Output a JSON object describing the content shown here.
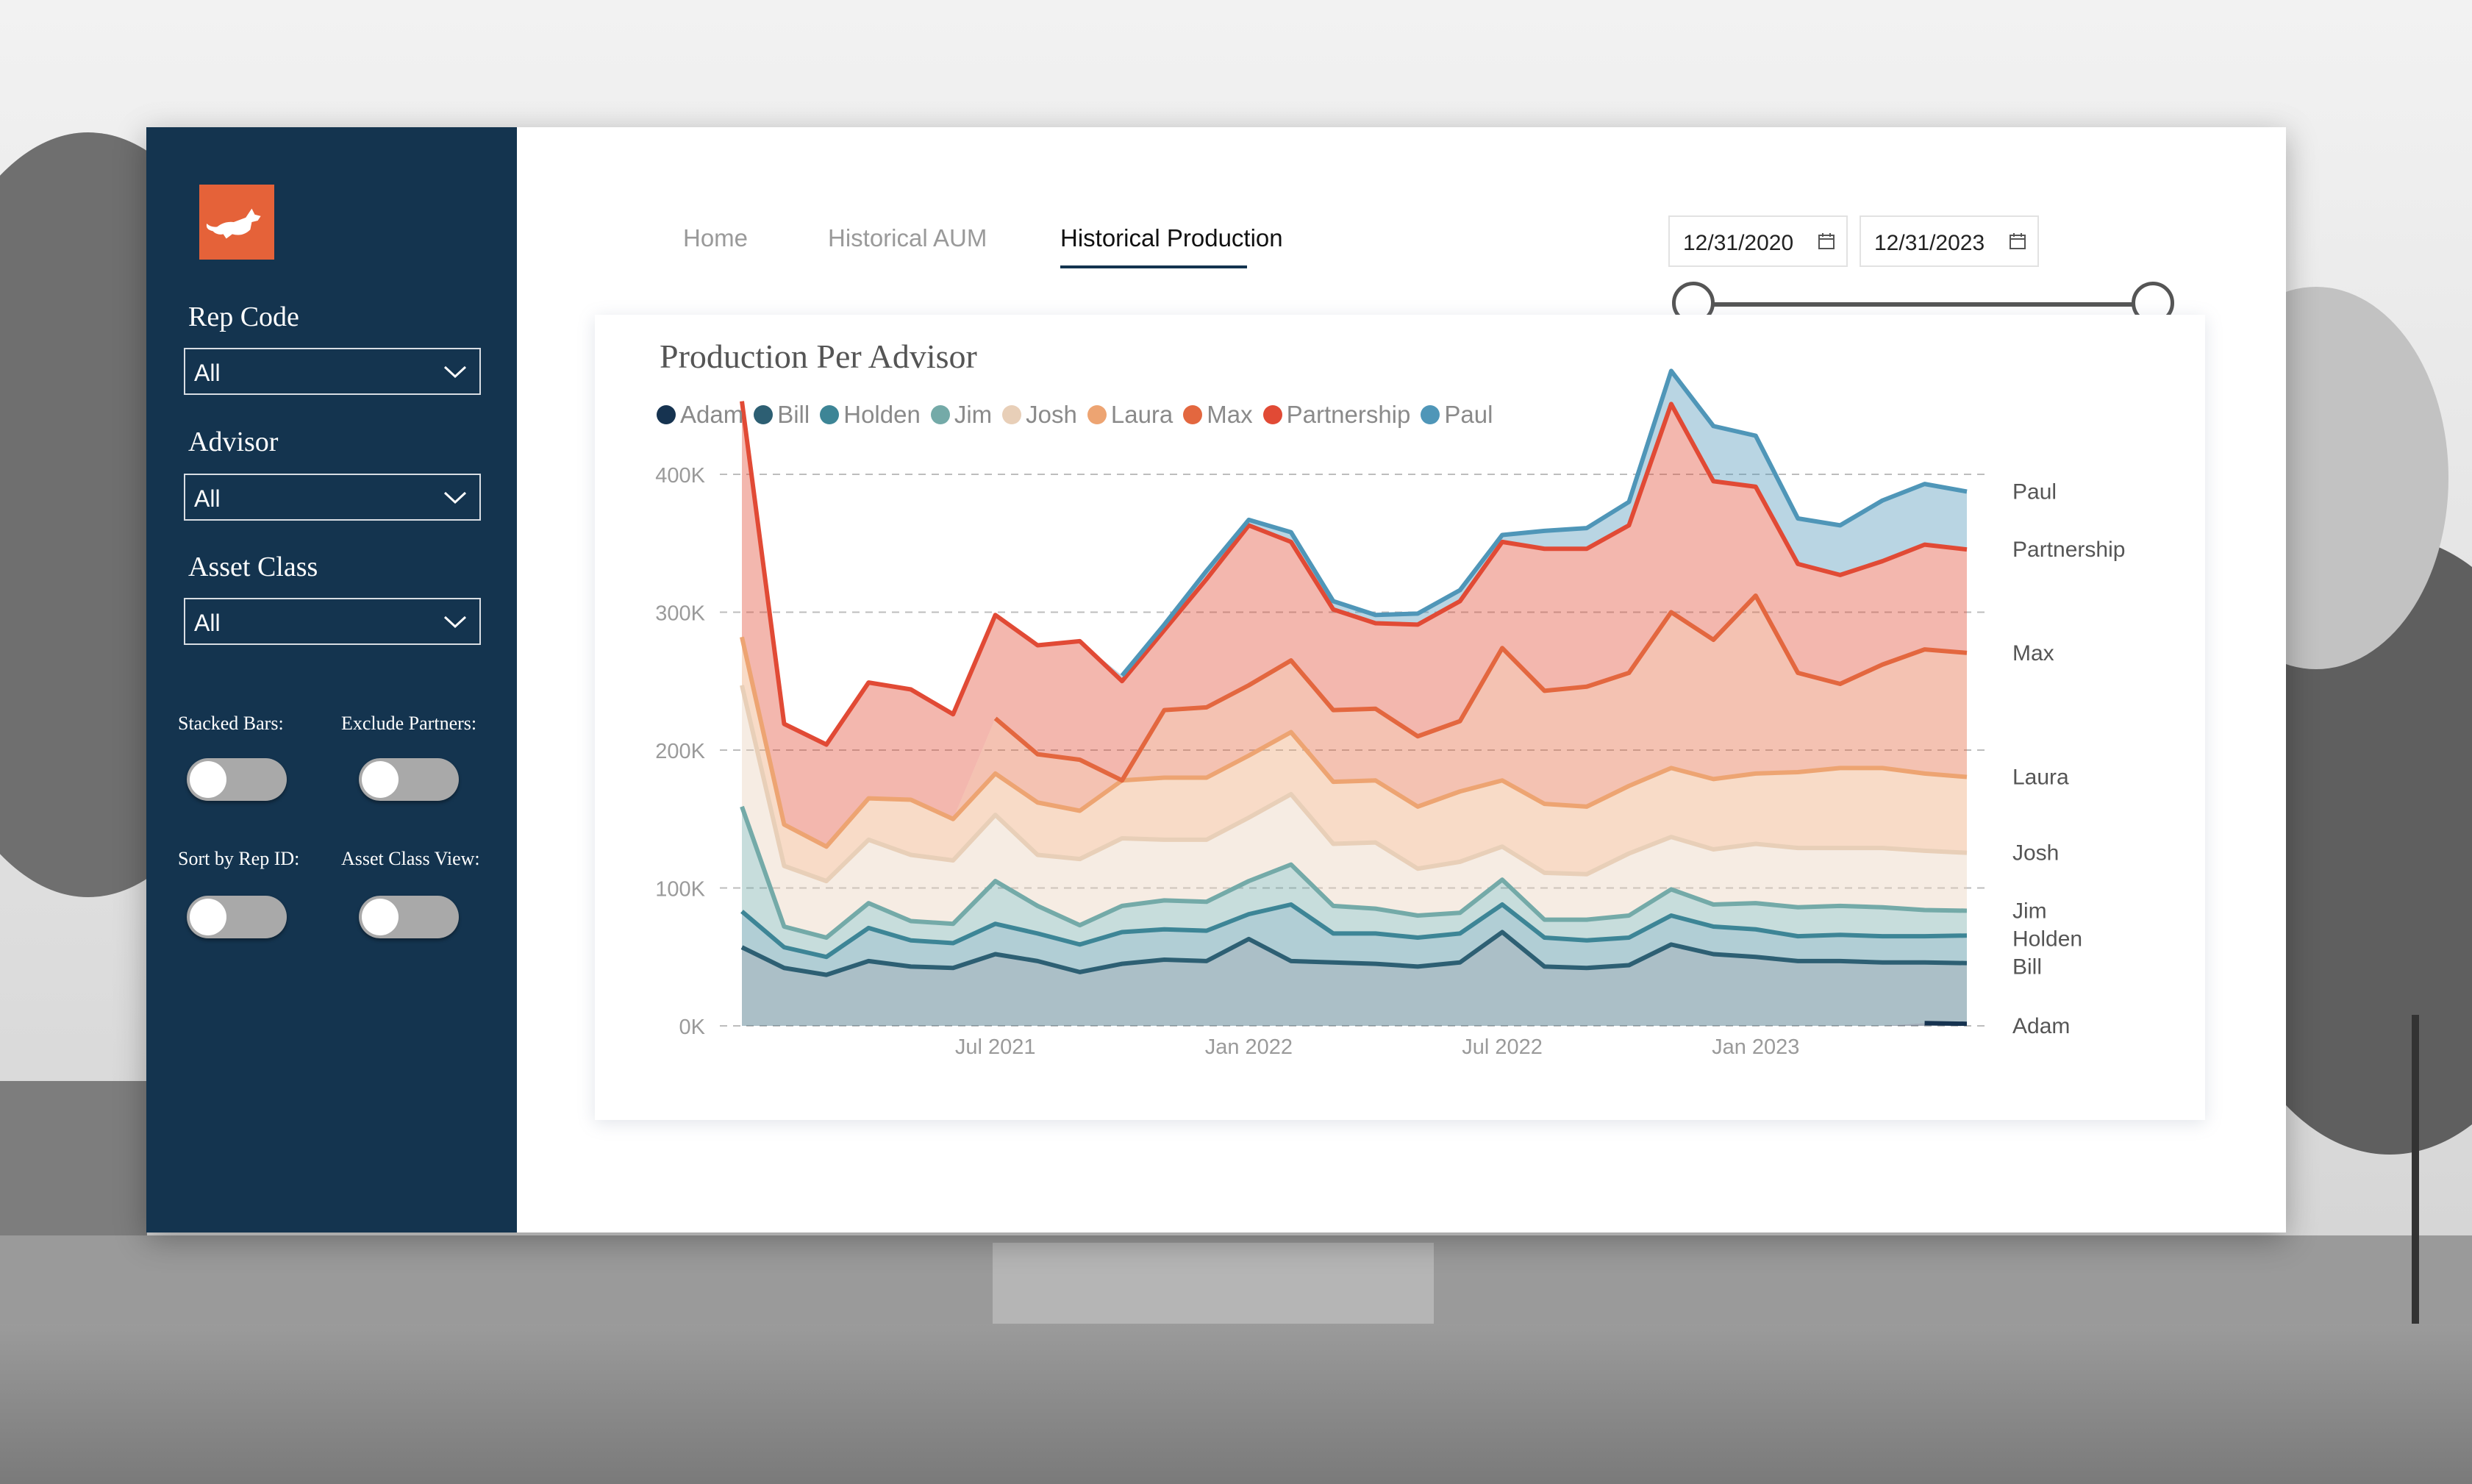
{
  "tabs": [
    {
      "label": "Home",
      "active": false
    },
    {
      "label": "Historical AUM",
      "active": false
    },
    {
      "label": "Historical Production",
      "active": true
    }
  ],
  "filters": {
    "rep_code": {
      "label": "Rep Code",
      "value": "All"
    },
    "advisor": {
      "label": "Advisor",
      "value": "All"
    },
    "asset_class": {
      "label": "Asset Class",
      "value": "All"
    }
  },
  "toggles": {
    "stacked_bars": {
      "label": "Stacked Bars:",
      "on": false
    },
    "exclude_partners": {
      "label": "Exclude Partners:",
      "on": false
    },
    "sort_by_rep_id": {
      "label": "Sort by Rep ID:",
      "on": false
    },
    "asset_class_view": {
      "label": "Asset Class View:",
      "on": false
    }
  },
  "date_range": {
    "start": "12/31/2020",
    "end": "12/31/2023"
  },
  "colors": {
    "sidebar": "#14344f",
    "accent": "#e56239"
  },
  "chart_data": {
    "type": "area",
    "stacked": true,
    "title": "Production Per Advisor",
    "xlabel": "",
    "ylabel": "",
    "x": [
      "2021-01",
      "2021-02",
      "2021-03",
      "2021-04",
      "2021-05",
      "2021-06",
      "2021-07",
      "2021-08",
      "2021-09",
      "2021-10",
      "2021-11",
      "2021-12",
      "2022-01",
      "2022-02",
      "2022-03",
      "2022-04",
      "2022-05",
      "2022-06",
      "2022-07",
      "2022-08",
      "2022-09",
      "2022-10",
      "2022-11",
      "2022-12",
      "2023-01",
      "2023-02",
      "2023-03",
      "2023-04",
      "2023-05",
      "2023-06"
    ],
    "x_ticks": [
      "Jul 2021",
      "Jan 2022",
      "Jul 2022",
      "Jan 2023"
    ],
    "x_tick_positions": [
      "2021-07",
      "2022-01",
      "2022-07",
      "2023-01"
    ],
    "ylim": [
      0,
      400000
    ],
    "y_ticks": [
      0,
      100000,
      200000,
      300000,
      400000
    ],
    "y_tick_labels": [
      "0K",
      "100K",
      "200K",
      "300K",
      "400K"
    ],
    "grid": true,
    "legend": "top-left",
    "series": [
      {
        "name": "Adam",
        "color": "#163350",
        "values": [
          0,
          0,
          0,
          0,
          0,
          0,
          0,
          0,
          0,
          0,
          0,
          0,
          0,
          0,
          0,
          0,
          0,
          0,
          0,
          0,
          0,
          0,
          0,
          0,
          0,
          0,
          0,
          0,
          2000,
          1500
        ]
      },
      {
        "name": "Bill",
        "color": "#2d5f73",
        "values": [
          57000,
          42000,
          37000,
          47000,
          43000,
          42000,
          52000,
          47000,
          39000,
          45000,
          48000,
          47000,
          63000,
          47000,
          46000,
          45000,
          43000,
          46000,
          68000,
          43000,
          42000,
          44000,
          59000,
          52000,
          50000,
          47000,
          47000,
          46000,
          44000,
          44000
        ]
      },
      {
        "name": "Holden",
        "color": "#3d8596",
        "values": [
          26000,
          15000,
          13000,
          24000,
          19000,
          18000,
          22000,
          20000,
          20000,
          23000,
          22000,
          22000,
          18000,
          41000,
          21000,
          22000,
          21000,
          21000,
          20000,
          21000,
          20000,
          20000,
          21000,
          20000,
          20000,
          18000,
          19000,
          19000,
          19000,
          20000
        ]
      },
      {
        "name": "Jim",
        "color": "#74aaa8",
        "values": [
          76000,
          15000,
          14000,
          18000,
          14000,
          14000,
          31000,
          20000,
          14000,
          19000,
          21000,
          21000,
          24000,
          29000,
          20000,
          18000,
          16000,
          15000,
          18000,
          13000,
          15000,
          16000,
          19000,
          16000,
          19000,
          21000,
          21000,
          21000,
          19000,
          18000
        ]
      },
      {
        "name": "Josh",
        "color": "#e8cfb8",
        "values": [
          88000,
          44000,
          41000,
          46000,
          48000,
          46000,
          48000,
          37000,
          48000,
          49000,
          44000,
          45000,
          46000,
          51000,
          45000,
          48000,
          34000,
          37000,
          24000,
          34000,
          33000,
          45000,
          38000,
          40000,
          43000,
          43000,
          42000,
          43000,
          43000,
          42000
        ]
      },
      {
        "name": "Laura",
        "color": "#eda472",
        "values": [
          35000,
          30000,
          25000,
          30000,
          40000,
          30000,
          30000,
          38000,
          35000,
          42000,
          45000,
          45000,
          45000,
          45000,
          45000,
          45000,
          45000,
          51000,
          48000,
          50000,
          49000,
          49000,
          50000,
          51000,
          51000,
          55000,
          58000,
          58000,
          56000,
          55000
        ]
      },
      {
        "name": "Max",
        "color": "#e3673f",
        "values": [
          0,
          0,
          0,
          0,
          0,
          0,
          40000,
          35000,
          37000,
          0,
          49000,
          51000,
          51000,
          52000,
          52000,
          52000,
          51000,
          51000,
          96000,
          82000,
          87000,
          82000,
          113000,
          101000,
          129000,
          72000,
          61000,
          75000,
          90000,
          90000
        ]
      },
      {
        "name": "Partnership",
        "color": "#e14a35",
        "values": [
          171000,
          73000,
          74000,
          84000,
          80000,
          76000,
          75000,
          79000,
          86000,
          72000,
          58000,
          93000,
          116000,
          86000,
          73000,
          62000,
          81000,
          87000,
          77000,
          103000,
          100000,
          107000,
          151000,
          115000,
          79000,
          79000,
          79000,
          75000,
          76000,
          75000
        ]
      },
      {
        "name": "Paul",
        "color": "#4f96b8",
        "values": [
          0,
          0,
          0,
          0,
          0,
          0,
          0,
          0,
          0,
          4000,
          4000,
          6000,
          4000,
          7000,
          6000,
          6000,
          8000,
          8000,
          5000,
          13000,
          15000,
          17000,
          24000,
          40000,
          37000,
          33000,
          36000,
          44000,
          44000,
          42000
        ]
      }
    ],
    "end_labels": [
      "Paul",
      "Partnership",
      "Max",
      "Laura",
      "Josh",
      "Jim",
      "Holden",
      "Bill",
      "Adam"
    ]
  }
}
